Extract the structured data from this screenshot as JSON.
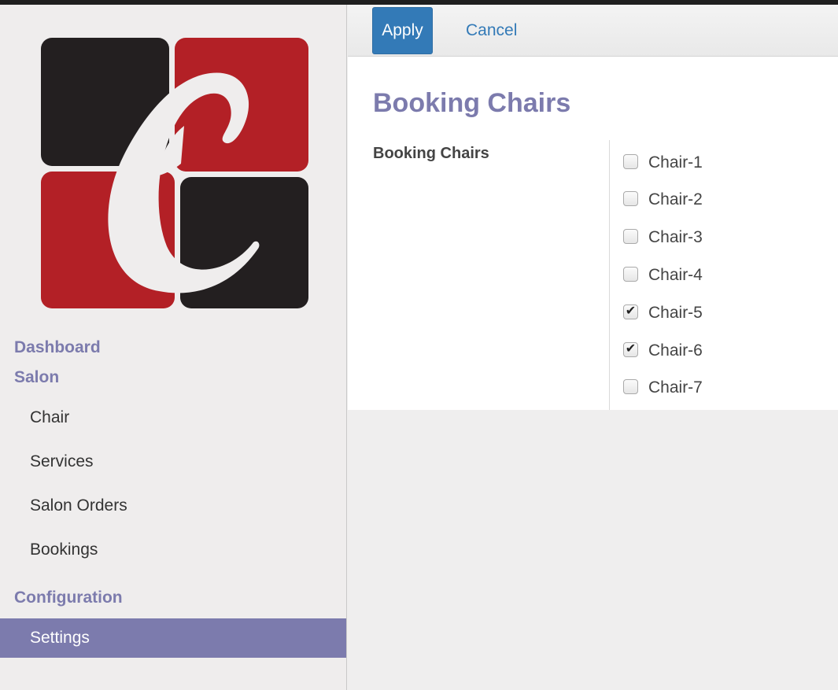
{
  "sidebar": {
    "menus": [
      {
        "label": "Dashboard"
      },
      {
        "label": "Salon"
      }
    ],
    "salon_items": [
      {
        "label": "Chair"
      },
      {
        "label": "Services"
      },
      {
        "label": "Salon Orders"
      },
      {
        "label": "Bookings"
      }
    ],
    "configuration": {
      "label": "Configuration"
    },
    "settings": {
      "label": "Settings",
      "active": true
    }
  },
  "toolbar": {
    "apply_label": "Apply",
    "cancel_label": "Cancel"
  },
  "form": {
    "title": "Booking Chairs",
    "field_label": "Booking Chairs",
    "chairs": [
      {
        "label": "Chair-1",
        "checked": false
      },
      {
        "label": "Chair-2",
        "checked": false
      },
      {
        "label": "Chair-3",
        "checked": false
      },
      {
        "label": "Chair-4",
        "checked": false
      },
      {
        "label": "Chair-5",
        "checked": true
      },
      {
        "label": "Chair-6",
        "checked": true
      },
      {
        "label": "Chair-7",
        "checked": false
      }
    ]
  },
  "colors": {
    "accent": "#7c7bad",
    "primary_button": "#337ab7",
    "logo_red": "#b32026",
    "logo_black": "#231f20"
  }
}
